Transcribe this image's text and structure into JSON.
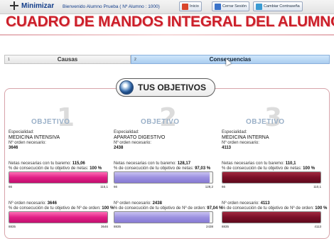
{
  "topbar": {
    "minimize_label": "Minimizar",
    "welcome_prefix": "Bienvenido",
    "welcome_user": "Alumno Prueba",
    "welcome_id": "( Nº Alumno : 1000)",
    "buttons": [
      {
        "label": "Inicio",
        "icon": "home-icon"
      },
      {
        "label": "Cerrar Sesión",
        "icon": "logout-icon"
      },
      {
        "label": "Cambiar Contraseña",
        "icon": "key-icon"
      }
    ]
  },
  "page_title": "CUADRO DE MANDOS INTEGRAL DEL ALUMNO",
  "tabs": [
    {
      "num": "1",
      "label": "Causas",
      "active": false
    },
    {
      "num": "2",
      "label": "Consecuencias",
      "active": true
    }
  ],
  "objectives_header": "TUS OBJETIVOS",
  "objective_word": "OBJETIVO",
  "labels": {
    "especialidad": "Especialidad:",
    "orden_necesario": "Nº orden necesario:",
    "netas_necesarias": "Netas necesarias con tu baremo:",
    "pct_netas": "% de consecución de tu objetivo de netas:",
    "orden_necesario2": "Nº orden necesario:",
    "pct_orden": "% de consecución de tu objetivo de Nº de orden:"
  },
  "objectives": [
    {
      "number": "1",
      "especialidad": "MEDICINA INTENSIVA",
      "orden": "3646",
      "netas": "115,06",
      "pct_netas": "100 %",
      "netas_bar": {
        "min": "66",
        "max": "115,1",
        "fill": 1.0,
        "color": "#e01f86"
      },
      "orden2": "3646",
      "pct_orden": "100 %",
      "orden_bar": {
        "min": "8835",
        "max": "3646",
        "fill": 1.0,
        "color": "#e01f86"
      }
    },
    {
      "number": "2",
      "especialidad": "APARATO DIGESTIVO",
      "orden": "2438",
      "netas": "128,17",
      "pct_netas": "97,03 %",
      "netas_bar": {
        "min": "66",
        "max": "128,2",
        "fill": 0.97,
        "color": "#9c91e0"
      },
      "orden2": "2438",
      "pct_orden": "97,04 %",
      "orden_bar": {
        "min": "8835",
        "max": "2438",
        "fill": 0.97,
        "color": "#9c91e0"
      }
    },
    {
      "number": "3",
      "especialidad": "MEDICINA INTERNA",
      "orden": "4113",
      "netas": "110,1",
      "pct_netas": "100 %",
      "netas_bar": {
        "min": "66",
        "max": "110,1",
        "fill": 1.0,
        "color": "#7a0f27"
      },
      "orden2": "4113",
      "pct_orden": "100 %",
      "orden_bar": {
        "min": "8835",
        "max": "4113",
        "fill": 1.0,
        "color": "#7a0f27"
      }
    }
  ]
}
